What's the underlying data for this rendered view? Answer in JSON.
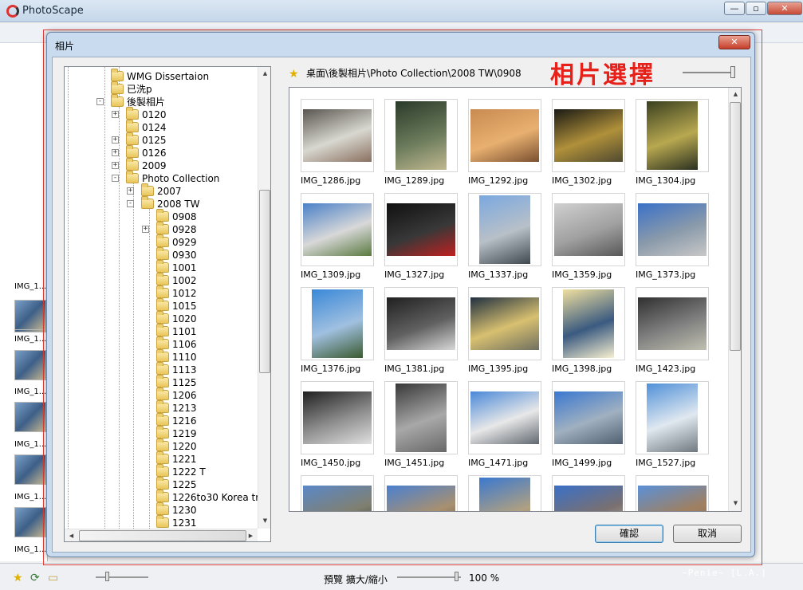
{
  "app": {
    "title": "PhotoScape",
    "win_min": "—",
    "win_max": "▫",
    "win_close": "✕",
    "side_labels": [
      "IMG_1...",
      "IMG_1...",
      "IMG_1...",
      "IMG_1...",
      "IMG_1...",
      "IMG_1..."
    ],
    "status": {
      "preview_label": "預覽 擴大/縮小",
      "zoom_value": "100 %",
      "watermark": "~Penie~ [L.A.]"
    }
  },
  "dialog": {
    "title": "相片",
    "close_label": "✕",
    "heading": "相片選擇",
    "path": "桌面\\後製相片\\Photo Collection\\2008 TW\\0908",
    "ok_label": "確認",
    "cancel_label": "取消"
  },
  "tree": {
    "rows": [
      {
        "label": "WMG Dissertaion",
        "depth": 0,
        "expander": ""
      },
      {
        "label": "已洗p",
        "depth": 0,
        "expander": ""
      },
      {
        "label": "後製相片",
        "depth": 0,
        "expander": "-"
      },
      {
        "label": "0120",
        "depth": 1,
        "expander": "+"
      },
      {
        "label": "0124",
        "depth": 1,
        "expander": ""
      },
      {
        "label": "0125",
        "depth": 1,
        "expander": "+"
      },
      {
        "label": "0126",
        "depth": 1,
        "expander": "+"
      },
      {
        "label": "2009",
        "depth": 1,
        "expander": "+"
      },
      {
        "label": "Photo Collection",
        "depth": 1,
        "expander": "-"
      },
      {
        "label": "2007",
        "depth": 2,
        "expander": "+"
      },
      {
        "label": "2008 TW",
        "depth": 2,
        "expander": "-"
      },
      {
        "label": "0908",
        "depth": 3,
        "expander": ""
      },
      {
        "label": "0928",
        "depth": 3,
        "expander": "+"
      },
      {
        "label": "0929",
        "depth": 3,
        "expander": ""
      },
      {
        "label": "0930",
        "depth": 3,
        "expander": ""
      },
      {
        "label": "1001",
        "depth": 3,
        "expander": ""
      },
      {
        "label": "1002",
        "depth": 3,
        "expander": ""
      },
      {
        "label": "1012",
        "depth": 3,
        "expander": ""
      },
      {
        "label": "1015",
        "depth": 3,
        "expander": ""
      },
      {
        "label": "1020",
        "depth": 3,
        "expander": ""
      },
      {
        "label": "1101",
        "depth": 3,
        "expander": ""
      },
      {
        "label": "1106",
        "depth": 3,
        "expander": ""
      },
      {
        "label": "1110",
        "depth": 3,
        "expander": ""
      },
      {
        "label": "1113",
        "depth": 3,
        "expander": ""
      },
      {
        "label": "1125",
        "depth": 3,
        "expander": ""
      },
      {
        "label": "1206",
        "depth": 3,
        "expander": ""
      },
      {
        "label": "1213",
        "depth": 3,
        "expander": ""
      },
      {
        "label": "1216",
        "depth": 3,
        "expander": ""
      },
      {
        "label": "1219",
        "depth": 3,
        "expander": ""
      },
      {
        "label": "1220",
        "depth": 3,
        "expander": ""
      },
      {
        "label": "1221",
        "depth": 3,
        "expander": ""
      },
      {
        "label": "1222 T",
        "depth": 3,
        "expander": ""
      },
      {
        "label": "1225",
        "depth": 3,
        "expander": ""
      },
      {
        "label": "1226to30 Korea tr",
        "depth": 3,
        "expander": ""
      },
      {
        "label": "1230",
        "depth": 3,
        "expander": ""
      },
      {
        "label": "1231",
        "depth": 3,
        "expander": ""
      }
    ]
  },
  "thumbnails": [
    {
      "name": "IMG_1286.jpg",
      "colors": [
        "#5a5550",
        "#d8d8d0",
        "#8a7060"
      ]
    },
    {
      "name": "IMG_1289.jpg",
      "colors": [
        "#2a3a2a",
        "#6a7a5a",
        "#c0b890"
      ]
    },
    {
      "name": "IMG_1292.jpg",
      "colors": [
        "#c88a50",
        "#e8b070",
        "#7a5030"
      ]
    },
    {
      "name": "IMG_1302.jpg",
      "colors": [
        "#1a1a14",
        "#b0903a",
        "#504a30"
      ]
    },
    {
      "name": "IMG_1304.jpg",
      "colors": [
        "#3a4020",
        "#b8a850",
        "#2a3020"
      ]
    },
    {
      "name": "IMG_1309.jpg",
      "colors": [
        "#4a80c8",
        "#d8d8d8",
        "#5a7a40"
      ]
    },
    {
      "name": "IMG_1327.jpg",
      "colors": [
        "#101010",
        "#383838",
        "#c02020"
      ]
    },
    {
      "name": "IMG_1337.jpg",
      "colors": [
        "#7aa8e0",
        "#b8c0c8",
        "#404850"
      ]
    },
    {
      "name": "IMG_1359.jpg",
      "colors": [
        "#d0d0d0",
        "#a0a0a0",
        "#585858"
      ]
    },
    {
      "name": "IMG_1373.jpg",
      "colors": [
        "#3a70c8",
        "#8a9aaa",
        "#c8c8c8"
      ]
    },
    {
      "name": "IMG_1376.jpg",
      "colors": [
        "#3a88d8",
        "#a0c0e0",
        "#3a5a30"
      ]
    },
    {
      "name": "IMG_1381.jpg",
      "colors": [
        "#202020",
        "#606060",
        "#d8d8d8"
      ]
    },
    {
      "name": "IMG_1395.jpg",
      "colors": [
        "#203040",
        "#d8c070",
        "#707060"
      ]
    },
    {
      "name": "IMG_1398.jpg",
      "colors": [
        "#f0e0a0",
        "#3a5a80",
        "#f8f0d0"
      ]
    },
    {
      "name": "IMG_1423.jpg",
      "colors": [
        "#303030",
        "#808080",
        "#c0c0b0"
      ]
    },
    {
      "name": "IMG_1450.jpg",
      "colors": [
        "#202020",
        "#909090",
        "#e0e0e0"
      ]
    },
    {
      "name": "IMG_1451.jpg",
      "colors": [
        "#383838",
        "#a8a8a8",
        "#686868"
      ]
    },
    {
      "name": "IMG_1471.jpg",
      "colors": [
        "#4a88d8",
        "#e8e8e8",
        "#606870"
      ]
    },
    {
      "name": "IMG_1499.jpg",
      "colors": [
        "#3a78d0",
        "#a0b0c0",
        "#506070"
      ]
    },
    {
      "name": "IMG_1527.jpg",
      "colors": [
        "#5090d8",
        "#e0e8f0",
        "#707880"
      ]
    },
    {
      "name": "",
      "colors": [
        "#5a88c8",
        "#808070",
        "#303030"
      ]
    },
    {
      "name": "",
      "colors": [
        "#4a80d0",
        "#a89070",
        "#605040"
      ]
    },
    {
      "name": "",
      "colors": [
        "#3a78d0",
        "#b0a080",
        "#706050"
      ]
    },
    {
      "name": "",
      "colors": [
        "#3a70c8",
        "#7a7070",
        "#c8c0b0"
      ]
    },
    {
      "name": "",
      "colors": [
        "#5a90d8",
        "#a08060",
        "#807060"
      ]
    }
  ]
}
